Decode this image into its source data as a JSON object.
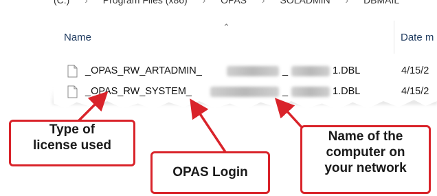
{
  "explorer": {
    "breadcrumb": [
      "(C:)",
      "Program Files (x86)",
      "OPAS",
      "SOLADMIN",
      "DBMAIL"
    ],
    "columns": {
      "name": "Name",
      "date": "Date m"
    },
    "files": [
      {
        "prefix": "_OPAS_RW_ARTADMIN_",
        "mid": "_",
        "suffix": "1.DBL",
        "date": "4/15/2"
      },
      {
        "prefix": "_OPAS_RW_SYSTEM_",
        "mid": "_",
        "suffix": "1.DBL",
        "date": "4/15/2"
      }
    ],
    "icons": {
      "file": "file-icon",
      "sort": "chevron-up-icon"
    }
  },
  "callouts": {
    "license": [
      "Type of",
      "license used"
    ],
    "login": [
      "OPAS Login"
    ],
    "computer": [
      "Name of the",
      "computer on",
      "your network"
    ]
  },
  "colors": {
    "accent": "#d9232a",
    "header_text": "#1e3a5f"
  }
}
